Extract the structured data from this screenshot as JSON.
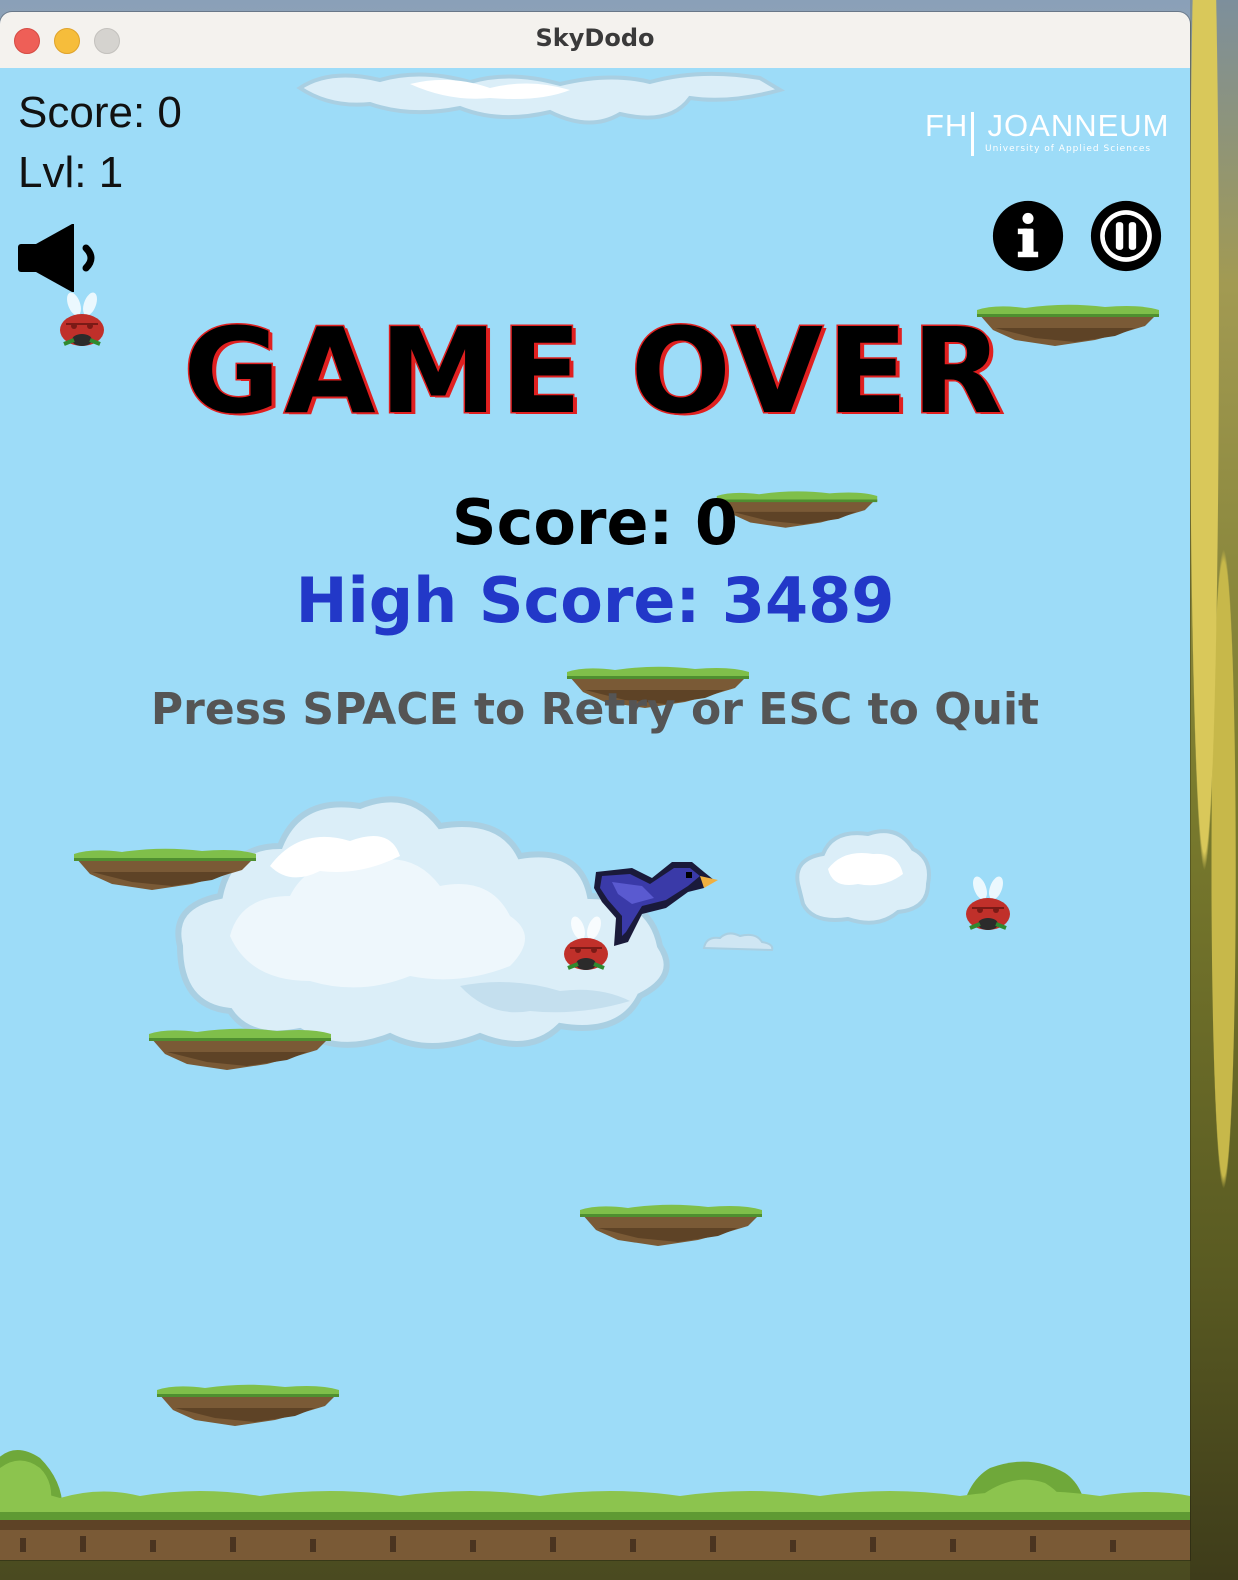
{
  "window": {
    "title": "SkyDodo"
  },
  "hud": {
    "score_text": "Score: 0",
    "level_text": "Lvl: 1"
  },
  "logo": {
    "name": "FH | JOANNEUM",
    "tagline": "University of Applied Sciences"
  },
  "game_over": {
    "title": "GAME OVER",
    "score_text": "Score: 0",
    "high_score_text": "High Score: 3489",
    "hint_text": "Press SPACE to Retry or ESC to Quit"
  },
  "colors": {
    "sky": "#9ddcf8",
    "title_outline": "#e02020",
    "high_score": "#2238c8",
    "hint": "#555555"
  },
  "icons": [
    "speaker-icon",
    "info-icon",
    "pause-icon"
  ]
}
